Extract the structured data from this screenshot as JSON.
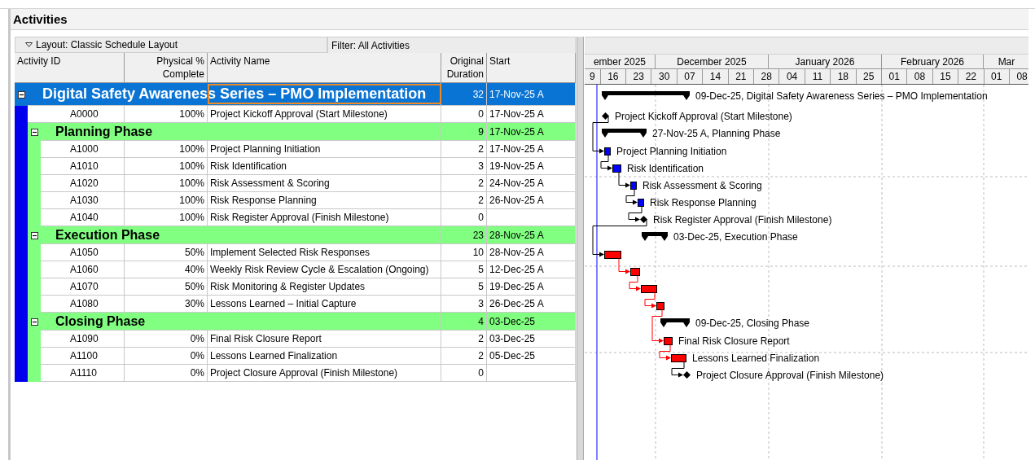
{
  "panel": {
    "title": "Activities"
  },
  "toolbar": {
    "layout": "Layout: Classic Schedule Layout",
    "filter": "Filter: All Activities"
  },
  "table": {
    "columns": [
      {
        "label": "Activity ID"
      },
      {
        "label": "Physical %\nComplete"
      },
      {
        "label": "Activity Name"
      },
      {
        "label": "Original\nDuration"
      },
      {
        "label": "Start"
      }
    ],
    "rows": [
      {
        "kind": "project",
        "name": "Digital Safety Awareness Series – PMO Implementation",
        "duration": "32",
        "start": "17-Nov-25 A",
        "selected": true,
        "expanded": true,
        "bar_label": "09-Dec-25, Digital Safety Awareness Series – PMO Implementation",
        "children": [
          {
            "kind": "milestone",
            "id": "A0000",
            "complete": "100%",
            "name": "Project Kickoff Approval (Start Milestone)",
            "duration": "0",
            "start": "17-Nov-25 A",
            "bar_label": "Project Kickoff Approval (Start Milestone)"
          },
          {
            "kind": "group",
            "name": "Planning Phase",
            "duration": "9",
            "start": "17-Nov-25 A",
            "expanded": true,
            "bar_label": "27-Nov-25 A, Planning Phase",
            "children": [
              {
                "kind": "task",
                "id": "A1000",
                "complete": "100%",
                "name": "Project Planning Initiation",
                "duration": "2",
                "start": "17-Nov-25 A",
                "bar_label": "Project Planning Initiation",
                "color": "#0000ff"
              },
              {
                "kind": "task",
                "id": "A1010",
                "complete": "100%",
                "name": "Risk Identification",
                "duration": "3",
                "start": "19-Nov-25 A",
                "bar_label": "Risk Identification",
                "color": "#0000ff"
              },
              {
                "kind": "task",
                "id": "A1020",
                "complete": "100%",
                "name": "Risk Assessment & Scoring",
                "duration": "2",
                "start": "24-Nov-25 A",
                "bar_label": "Risk Assessment & Scoring",
                "color": "#0000ff"
              },
              {
                "kind": "task",
                "id": "A1030",
                "complete": "100%",
                "name": "Risk Response Planning",
                "duration": "2",
                "start": "26-Nov-25 A",
                "bar_label": "Risk Response Planning",
                "color": "#0000ff"
              },
              {
                "kind": "milestone",
                "id": "A1040",
                "complete": "100%",
                "name": "Risk Register Approval (Finish Milestone)",
                "duration": "0",
                "bar_label": "Risk Register Approval (Finish Milestone)"
              }
            ]
          },
          {
            "kind": "group",
            "name": "Execution Phase",
            "duration": "23",
            "start": "28-Nov-25 A",
            "expanded": true,
            "bar_label": "03-Dec-25, Execution Phase",
            "children": [
              {
                "kind": "task",
                "id": "A1050",
                "complete": "50%",
                "name": "Implement Selected Risk Responses",
                "duration": "10",
                "start": "28-Nov-25 A",
                "color": "#ff0000"
              },
              {
                "kind": "task",
                "id": "A1060",
                "complete": "40%",
                "name": "Weekly Risk Review Cycle & Escalation (Ongoing)",
                "duration": "5",
                "start": "12-Dec-25 A",
                "color": "#ff0000"
              },
              {
                "kind": "task",
                "id": "A1070",
                "complete": "50%",
                "name": "Risk Monitoring & Register Updates",
                "duration": "5",
                "start": "19-Dec-25 A",
                "color": "#ff0000"
              },
              {
                "kind": "task",
                "id": "A1080",
                "complete": "30%",
                "name": "Lessons Learned – Initial Capture",
                "duration": "3",
                "start": "26-Dec-25 A",
                "color": "#ff0000"
              }
            ]
          },
          {
            "kind": "group",
            "name": "Closing Phase",
            "duration": "4",
            "start": "03-Dec-25",
            "expanded": true,
            "bar_label": "09-Dec-25, Closing Phase",
            "children": [
              {
                "kind": "task",
                "id": "A1090",
                "complete": "0%",
                "name": "Final Risk Closure Report",
                "duration": "2",
                "start": "03-Dec-25",
                "bar_label": "Final Risk Closure Report",
                "color": "#ff0000"
              },
              {
                "kind": "task",
                "id": "A1100",
                "complete": "0%",
                "name": "Lessons Learned Finalization",
                "duration": "2",
                "start": "05-Dec-25",
                "bar_label": "Lessons Learned Finalization",
                "color": "#ff0000"
              },
              {
                "kind": "milestone",
                "id": "A1110",
                "complete": "0%",
                "name": "Project Closure Approval (Finish Milestone)",
                "duration": "0",
                "bar_label": "Project Closure Approval (Finish Milestone)"
              }
            ]
          }
        ]
      }
    ]
  },
  "gantt": {
    "months": [
      "ember 2025",
      "December 2025",
      "January 2026",
      "February 2026",
      "Mar"
    ],
    "weeks": [
      "9",
      "16",
      "23",
      "30",
      "07",
      "14",
      "21",
      "28",
      "04",
      "11",
      "18",
      "25",
      "01",
      "08",
      "15",
      "22",
      "01",
      "08"
    ]
  }
}
